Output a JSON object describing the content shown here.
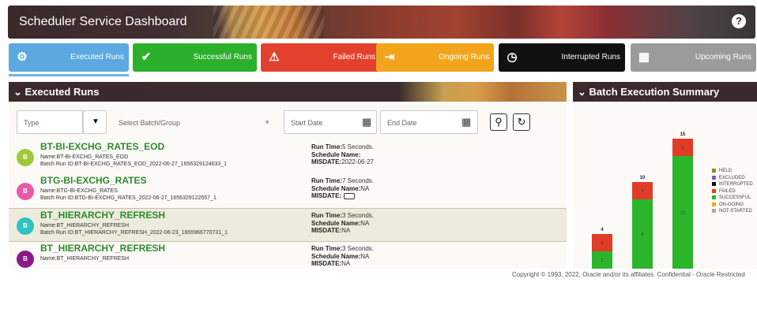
{
  "header": {
    "title": "Scheduler Service Dashboard",
    "help_icon": "?"
  },
  "tiles": [
    {
      "label": "Executed Runs",
      "icon": "executed-runs-icon",
      "glyph": "⚙",
      "color": "#5ba9e0"
    },
    {
      "label": "Successful Runs",
      "icon": "check-icon",
      "glyph": "✔",
      "color": "#2bb02b"
    },
    {
      "label": "Failed Runs",
      "icon": "warning-icon",
      "glyph": "⚠",
      "color": "#e2412e"
    },
    {
      "label": "Ongoing Runs",
      "icon": "ongoing-icon",
      "glyph": "⇥",
      "color": "#f2a51c"
    },
    {
      "label": "Interrupted Runs",
      "icon": "interrupted-icon",
      "glyph": "◷",
      "color": "#111111"
    },
    {
      "label": "Upcoming Runs",
      "icon": "calendar-icon",
      "glyph": "▦",
      "color": "#9b9b9b"
    }
  ],
  "executed_runs": {
    "title": "Executed Runs",
    "filters": {
      "type_placeholder": "Type",
      "batch_placeholder": "Select Batch/Group",
      "start_date_placeholder": "Start Date",
      "end_date_placeholder": "End Date"
    },
    "runs": [
      {
        "badge": "B",
        "badge_color": "#9fc83a",
        "name": "BT-BI-EXCHG_RATES_EOD",
        "detail_name": "Name:BT-BI-EXCHG_RATES_EOD",
        "batch_run_id": "Batch Run ID:BT-BI-EXCHG_RATES_EOD_2022-06-27_1656329124633_1",
        "run_time": "5 Seconds.",
        "schedule_name": "",
        "misdate": "2022-06-27",
        "selected": false
      },
      {
        "badge": "B",
        "badge_color": "#e85aa8",
        "name": "BTG-BI-EXCHG_RATES",
        "detail_name": "Name:BTG-BI-EXCHG_RATES",
        "batch_run_id": "Batch Run ID:BTG-BI-EXCHG_RATES_2022-06-27_1656329122557_1",
        "run_time": "7 Seconds.",
        "schedule_name": "NA",
        "misdate": "",
        "selected": false
      },
      {
        "badge": "B",
        "badge_color": "#2cc4c4",
        "name": "BT_HIERARCHY_REFRESH",
        "detail_name": "Name:BT_HIERARCHY_REFRESH",
        "batch_run_id": "Batch Run ID:BT_HIERARCHY_REFRESH_2022-06-23_1655966770731_1",
        "run_time": "3 Seconds.",
        "schedule_name": "NA",
        "misdate": "NA",
        "selected": true
      },
      {
        "badge": "B",
        "badge_color": "#8a1a8a",
        "name": "BT_HIERARCHY_REFRESH",
        "detail_name": "Name:BT_HIERARCHY_REFRESH",
        "batch_run_id": "",
        "run_time": "3 Seconds.",
        "schedule_name": "NA",
        "misdate": "NA",
        "selected": false
      }
    ],
    "labels": {
      "run_time": "Run Time:",
      "schedule_name": "Schedule Name:",
      "misdate": "MISDATE:"
    }
  },
  "batch_summary": {
    "title": "Batch Execution Summary"
  },
  "chart_data": {
    "type": "bar",
    "stacked": true,
    "categories": [
      "",
      "",
      ""
    ],
    "totals": [
      4,
      10,
      15
    ],
    "series": [
      {
        "name": "FAILED",
        "color": "#e03c28",
        "values": [
          2,
          2,
          2
        ]
      },
      {
        "name": "SUCCESSFUL",
        "color": "#2bb52b",
        "values": [
          2,
          8,
          13
        ]
      }
    ],
    "legend": [
      {
        "name": "HELD",
        "color": "#8a8a2a"
      },
      {
        "name": "EXCLUDED",
        "color": "#7b5bc8"
      },
      {
        "name": "INTERRUPTED",
        "color": "#111111"
      },
      {
        "name": "FAILED",
        "color": "#e03c28"
      },
      {
        "name": "SUCCESSFUL",
        "color": "#2bb52b"
      },
      {
        "name": "ON-GOING",
        "color": "#f2a51c"
      },
      {
        "name": "NOT-STARTED",
        "color": "#a9a9a9"
      }
    ],
    "legend_position": "right",
    "ylim": [
      0,
      15
    ]
  },
  "footer": {
    "copyright": "Copyright © 1993, 2022, Oracle and/or its affiliates.  Confidential - Oracle Restricted"
  }
}
